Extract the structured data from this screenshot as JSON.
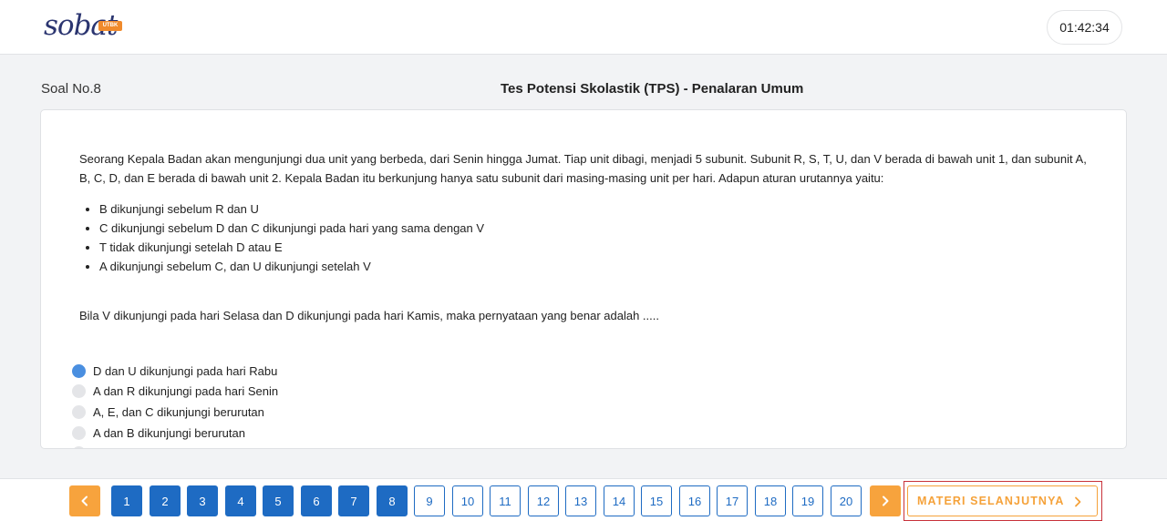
{
  "header": {
    "logo_text": "sobat",
    "logo_tag": "UTBK",
    "timer": "01:42:34"
  },
  "question": {
    "number_label": "Soal No.8",
    "title": "Tes Potensi Skolastik (TPS) - Penalaran Umum",
    "text": "Seorang Kepala Badan akan mengunjungi dua unit yang berbeda, dari Senin hingga Jumat.  Tiap unit dibagi, menjadi 5 subunit. Subunit R, S, T, U, dan V berada di bawah unit 1, dan subunit A, B, C, D, dan E berada di bawah unit 2. Kepala Badan itu berkunjung hanya satu subunit dari masing-masing unit per hari. Adapun aturan urutannya yaitu:",
    "rules": [
      "B dikunjungi sebelum R dan U",
      "C dikunjungi sebelum D dan C dikunjungi pada hari yang sama dengan V",
      "T tidak dikunjungi setelah D atau E",
      "A dikunjungi sebelum C, dan U dikunjungi setelah V"
    ],
    "prompt": "Bila V dikunjungi pada hari Selasa dan D dikunjungi pada hari Kamis, maka pernyataan yang benar adalah .....",
    "options": [
      {
        "label": "D dan U dikunjungi pada hari Rabu",
        "selected": true
      },
      {
        "label": "A dan R dikunjungi pada hari Senin",
        "selected": false
      },
      {
        "label": "A, E, dan C dikunjungi berurutan",
        "selected": false
      },
      {
        "label": "A dan B dikunjungi berurutan",
        "selected": false
      }
    ]
  },
  "pagination": {
    "prev_icon": "chevron-left-icon",
    "next_icon": "chevron-right-icon",
    "pages": [
      "1",
      "2",
      "3",
      "4",
      "5",
      "6",
      "7",
      "8",
      "9",
      "10",
      "11",
      "12",
      "13",
      "14",
      "15",
      "16",
      "17",
      "18",
      "19",
      "20"
    ],
    "answered_through": 8,
    "next_material_label": "MATERI SELANJUTNYA"
  },
  "colors": {
    "primary_blue": "#1e6bc3",
    "accent_orange": "#f7a33d",
    "selected_radio": "#4a8fe0",
    "highlight_border": "#c8323a"
  }
}
